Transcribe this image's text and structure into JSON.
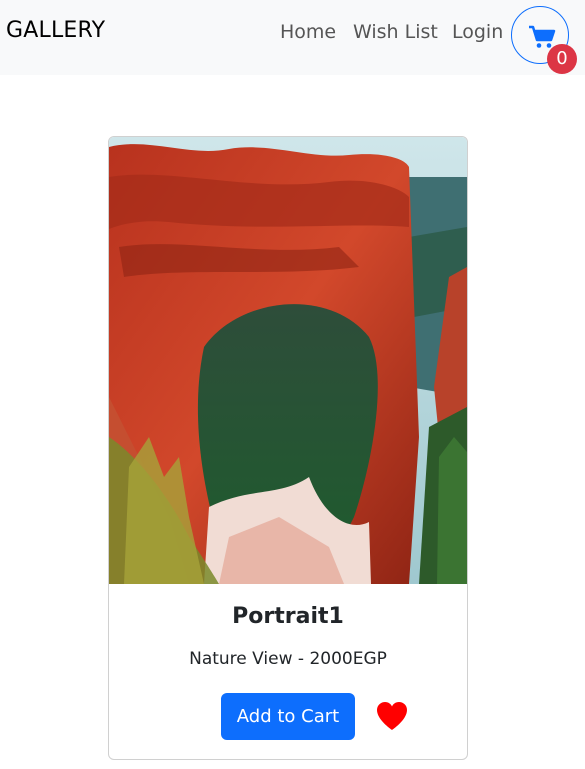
{
  "navbar": {
    "brand": "GALLERY",
    "links": [
      "Home",
      "Wish List",
      "Login"
    ],
    "cart_icon": "cart-icon",
    "cart_count": "0",
    "colors": {
      "background": "#f8f9fa",
      "accent": "#0d6efd",
      "badge": "#dc3545"
    }
  },
  "product": {
    "image_icon": "painting-image",
    "title": "Portrait1",
    "description": "Nature View - 2000EGP",
    "add_button_label": "Add to Cart",
    "wish_icon": "heart-icon",
    "colors": {
      "button": "#0d6efd",
      "heart": "#ff0000"
    }
  }
}
